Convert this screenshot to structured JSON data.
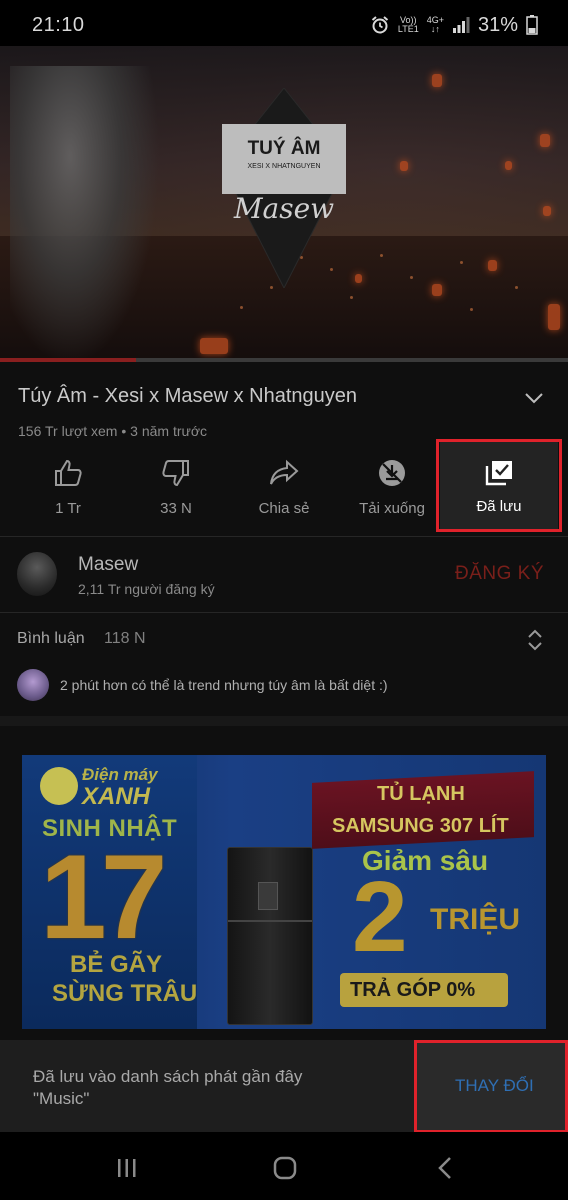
{
  "status_bar": {
    "time": "21:10",
    "net_top": "Vo))",
    "net_bottom": "LTE1",
    "net_type": "4G+",
    "battery": "31%"
  },
  "video": {
    "logo_title": "TUÝ ÂM",
    "logo_sub": "XESI X NHATNGUYEN",
    "logo_script": "Masew",
    "progress": 0.24
  },
  "info": {
    "title": "Túy Âm - Xesi x Masew x Nhatnguyen",
    "meta": "156 Tr lượt xem • 3 năm trước"
  },
  "actions": {
    "like": "1 Tr",
    "dislike": "33 N",
    "share": "Chia sẻ",
    "download": "Tải xuống",
    "saved": "Đã lưu"
  },
  "channel": {
    "name": "Masew",
    "subscribers": "2,11 Tr người đăng ký",
    "subscribe_label": "ĐĂNG KÝ"
  },
  "comments": {
    "label": "Bình luận",
    "count": "118 N",
    "top_comment": "2 phút hơn có thể là trend nhưng túy âm là bất diệt :)"
  },
  "ad": {
    "brand_top": "Điện máy",
    "brand_main": "XANH",
    "birthday": "SINH NHẬT",
    "number": "17",
    "slogan_line1": "BẺ GÃY",
    "slogan_line2": "SỪNG TRÂU",
    "ribbon_line1": "TỦ LẠNH",
    "ribbon_line2": "SAMSUNG 307 LÍT",
    "discount_label": "Giảm sâu",
    "discount_number": "2",
    "discount_unit": "TRIỆU",
    "installment": "TRẢ GÓP 0%"
  },
  "snackbar": {
    "line1": "Đã lưu vào danh sách phát gần đây",
    "line2": "\"Music\"",
    "action_label": "THAY ĐỔI"
  },
  "icons": {
    "status": [
      "alarm-icon",
      "signal-icon",
      "battery-icon"
    ],
    "actions": [
      "thumbs-up-icon",
      "thumbs-down-icon",
      "share-icon",
      "download-off-icon",
      "saved-playlist-icon"
    ],
    "nav": [
      "recent-apps-icon",
      "home-icon",
      "back-icon"
    ]
  },
  "colors": {
    "highlight": "#e0222b",
    "subscribe": "#7a1f1a",
    "snack_action": "#2f6fb4",
    "progress": "#8a1f1f"
  }
}
